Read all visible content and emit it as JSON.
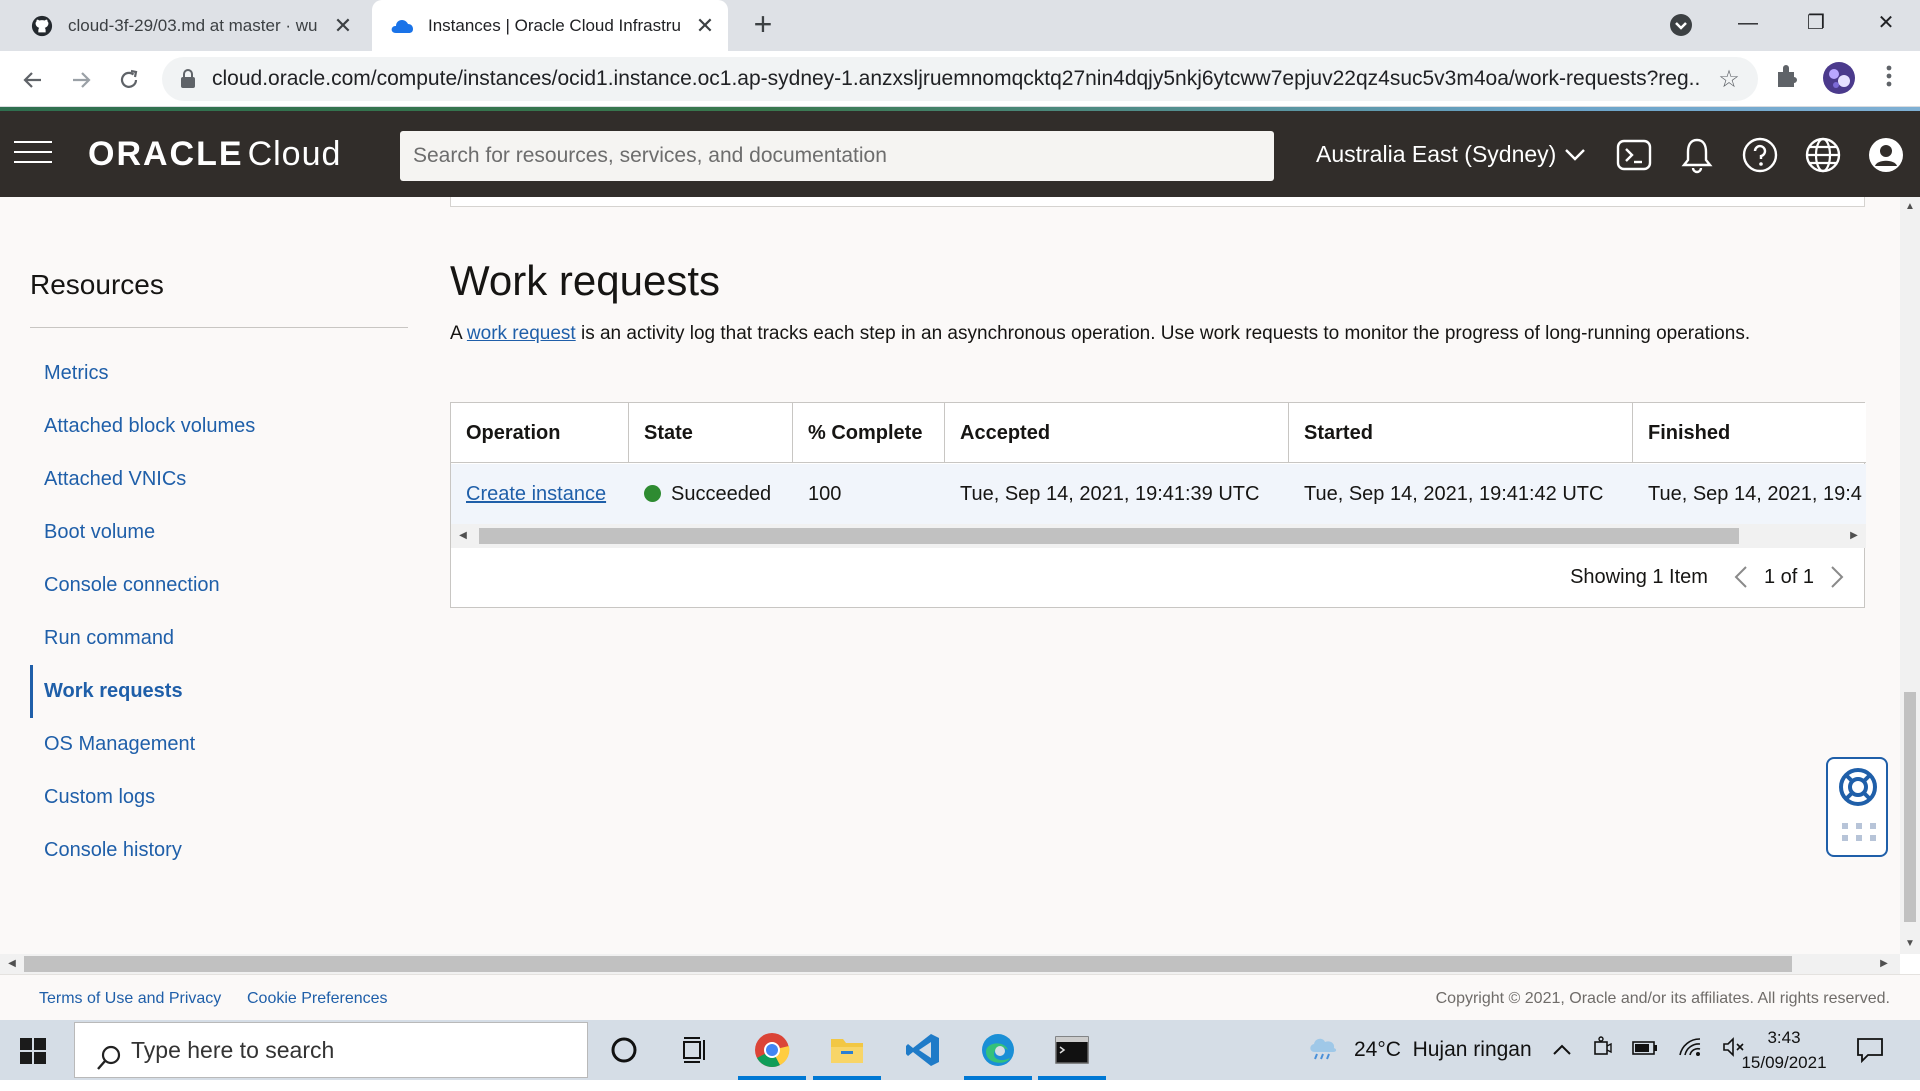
{
  "browser": {
    "tabs": [
      {
        "title": "cloud-3f-29/03.md at master · wu",
        "favicon": "github-icon",
        "active": false
      },
      {
        "title": "Instances | Oracle Cloud Infrastru",
        "favicon": "cloud-icon",
        "active": true
      }
    ],
    "url": "cloud.oracle.com/compute/instances/ocid1.instance.oc1.ap-sydney-1.anzxsljruemnomqcktq27nin4dqjy5nkj6ytcww7epjuv22qz4suc5v3m4oa/work-requests?reg..."
  },
  "header": {
    "logo_brand": "ORACLE",
    "logo_product": "Cloud",
    "search_placeholder": "Search for resources, services, and documentation",
    "region": "Australia East (Sydney)"
  },
  "resources": {
    "title": "Resources",
    "items": [
      {
        "label": "Metrics",
        "active": false
      },
      {
        "label": "Attached block volumes",
        "active": false
      },
      {
        "label": "Attached VNICs",
        "active": false
      },
      {
        "label": "Boot volume",
        "active": false
      },
      {
        "label": "Console connection",
        "active": false
      },
      {
        "label": "Run command",
        "active": false
      },
      {
        "label": "Work requests",
        "active": true
      },
      {
        "label": "OS Management",
        "active": false
      },
      {
        "label": "Custom logs",
        "active": false
      },
      {
        "label": "Console history",
        "active": false
      }
    ]
  },
  "work_requests": {
    "title": "Work requests",
    "desc_prefix": "A ",
    "desc_link": "work request",
    "desc_suffix": " is an activity log that tracks each step in an asynchronous operation. Use work requests to monitor the progress of long-running operations.",
    "columns": [
      "Operation",
      "State",
      "% Complete",
      "Accepted",
      "Started",
      "Finished"
    ],
    "rows": [
      {
        "operation": "Create instance",
        "state": "Succeeded",
        "complete": "100",
        "accepted": "Tue, Sep 14, 2021, 19:41:39 UTC",
        "started": "Tue, Sep 14, 2021, 19:41:42 UTC",
        "finished": "Tue, Sep 14, 2021, 19:4"
      }
    ],
    "showing": "Showing 1 Item",
    "page": "1 of 1"
  },
  "footer": {
    "terms": "Terms of Use and Privacy",
    "cookies": "Cookie Preferences",
    "copyright": "Copyright © 2021, Oracle and/or its affiliates. All rights reserved."
  },
  "taskbar": {
    "search_placeholder": "Type here to search",
    "weather": "24°C  Hujan ringan",
    "time": "3:43",
    "date": "15/09/2021"
  },
  "colors": {
    "oracle_header": "#312d2a",
    "link": "#1f5fa9",
    "success": "#2e8b31"
  }
}
